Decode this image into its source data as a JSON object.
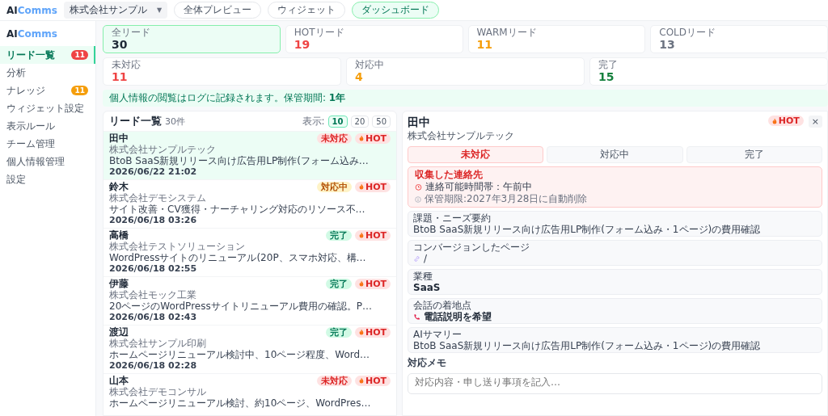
{
  "topbar": {
    "logo_a": "AI",
    "logo_b": "Comms",
    "company_select": "株式会社サンプル",
    "caret": "▼",
    "nav": [
      {
        "label": "全体プレビュー",
        "selected": false
      },
      {
        "label": "ウィジェット",
        "selected": false
      },
      {
        "label": "ダッシュボード",
        "selected": true
      }
    ]
  },
  "sidebar": {
    "logo_a": "AI",
    "logo_b": "Comms",
    "items": [
      {
        "label": "リード一覧",
        "selected": true,
        "badge": "11",
        "color": "#ef4444"
      },
      {
        "label": "分析",
        "selected": false
      },
      {
        "label": "ナレッジ",
        "selected": false,
        "badge": "11",
        "color": "#f59e0b"
      },
      {
        "label": "ウィジェット設定",
        "selected": false
      },
      {
        "label": "表示ルール",
        "selected": false
      },
      {
        "label": "チーム管理",
        "selected": false
      },
      {
        "label": "個人情報管理",
        "selected": false
      },
      {
        "label": "設定",
        "selected": false
      }
    ]
  },
  "stats_row_1": [
    {
      "label": "全リード",
      "value": "30",
      "color": "#1f2937",
      "selected": true
    },
    {
      "label": "HOTリード",
      "value": "19",
      "color": "#ef4444",
      "selected": false
    },
    {
      "label": "WARMリード",
      "value": "11",
      "color": "#f59e0b",
      "selected": false
    },
    {
      "label": "COLDリード",
      "value": "13",
      "color": "#6b7280",
      "selected": false
    }
  ],
  "stats_row_2": [
    {
      "label": "未対応",
      "value": "11",
      "color": "#ef4444",
      "selected": false
    },
    {
      "label": "対応中",
      "value": "4",
      "color": "#f59e0b",
      "selected": false
    },
    {
      "label": "完了",
      "value": "15",
      "color": "#15803d",
      "selected": false
    }
  ],
  "notice": "個人情報の閲覧はログに記録されます。保管期間: **1年**",
  "lead_list": {
    "title": "リード一覧",
    "count": "30件",
    "page_size_label": "表示:",
    "page_sizes": [
      {
        "label": "10",
        "selected": true
      },
      {
        "label": "20",
        "selected": false
      },
      {
        "label": "50",
        "selected": false
      }
    ],
    "leads": [
      {
        "name": "田中",
        "status": "未対応",
        "kind": "new",
        "temperature": "HOT",
        "company": "株式会社サンプルテック",
        "summary": "BtoB SaaS新規リリース向け広告用LP制作(フォーム込み…",
        "date": "2026/06/22 21:02",
        "selected": true
      },
      {
        "name": "鈴木",
        "status": "対応中",
        "kind": "in_progress",
        "temperature": "HOT",
        "company": "株式会社デモシステム",
        "summary": "サイト改善・CV獲得・ナーチャリング対応のリソース不…",
        "date": "2026/06/18 03:26",
        "selected": false
      },
      {
        "name": "高橋",
        "status": "完了",
        "kind": "done",
        "temperature": "HOT",
        "company": "株式会社テストソリューション",
        "summary": "WordPressサイトのリニューアル(20P、スマホ対応、構…",
        "date": "2026/06/18 02:55",
        "selected": false
      },
      {
        "name": "伊藤",
        "status": "完了",
        "kind": "done",
        "temperature": "HOT",
        "company": "株式会社モック工業",
        "summary": "20ページのWordPressサイトリニューアル費用の確認。P…",
        "date": "2026/06/18 02:43",
        "selected": false
      },
      {
        "name": "渡辺",
        "status": "完了",
        "kind": "done",
        "temperature": "HOT",
        "company": "株式会社サンプル印刷",
        "summary": "ホームページリニューアル検討中、10ページ程度、Word…",
        "date": "2026/06/18 02:28",
        "selected": false
      },
      {
        "name": "山本",
        "status": "未対応",
        "kind": "new",
        "temperature": "HOT",
        "company": "株式会社デモコンサル",
        "summary": "ホームページリニューアル検討、約10ページ、WordPres…",
        "selected": false
      }
    ]
  },
  "detail": {
    "name": "田中",
    "company": "株式会社サンプルテック",
    "temperature": "HOT",
    "close": "×",
    "status_tabs": [
      {
        "label": "未対応",
        "selected": true
      },
      {
        "label": "対応中",
        "selected": false
      },
      {
        "label": "完了",
        "selected": false
      }
    ],
    "contact": {
      "title": "収集した連絡先",
      "availability": "連絡可能時間帯：午前中",
      "retention": "保管期限:2027年3月28日に自動削除"
    },
    "fields": [
      {
        "label": "課題・ニーズ要約",
        "value": "BtoB SaaS新規リリース向け広告用LP制作(フォーム込み・1ページ)の費用確認",
        "kind": "text"
      },
      {
        "label": "コンバージョンしたページ",
        "value": "/",
        "kind": "link"
      },
      {
        "label": "業種",
        "value": "SaaS",
        "kind": "bold"
      },
      {
        "label": "会話の着地点",
        "value": "電話説明を希望",
        "kind": "phone"
      },
      {
        "label": "AIサマリー",
        "value": "BtoB SaaS新規リリース向け広告用LP制作(フォーム込み・1ページ)の費用確認",
        "kind": "text"
      }
    ],
    "memo_label": "対応メモ",
    "memo_placeholder": "対応内容・申し送り事項を記入…"
  }
}
